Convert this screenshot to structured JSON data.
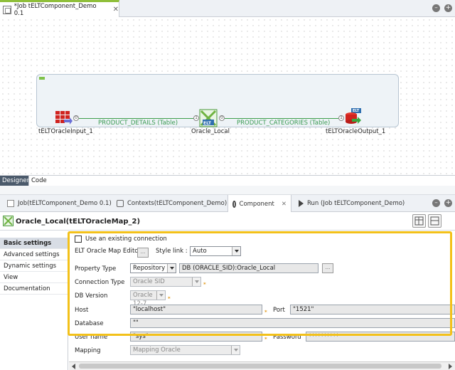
{
  "editor": {
    "tab_label": "*Job tELTComponent_Demo 0.1"
  },
  "canvas": {
    "components": {
      "input": "tELTOracleInput_1",
      "map": "Oracle_Local",
      "output": "tELTOracleOutput_1",
      "elt_badge": "ELT"
    },
    "flows": {
      "first": "PRODUCT_DETAILS (Table)",
      "second": "PRODUCT_CATEGORIES (Table)"
    },
    "ports": {
      "out0": "0",
      "in0": "1",
      "in0b": "0",
      "in1": "1"
    }
  },
  "designer_tabs": {
    "designer": "Designer",
    "code": "Code"
  },
  "view_tabs": {
    "job": "Job(tELTComponent_Demo 0.1)",
    "contexts": "Contexts(tELTComponent_Demo)",
    "component": "Component",
    "run": "Run (Job tELTComponent_Demo)"
  },
  "component": {
    "title": "Oracle_Local(tELTOracleMap_2)"
  },
  "nav": {
    "items": [
      "Basic settings",
      "Advanced settings",
      "Dynamic settings",
      "View",
      "Documentation"
    ]
  },
  "settings": {
    "use_existing_connection": "Use an existing connection",
    "map_editor_label": "ELT Oracle Map Editor",
    "ellipsis": "...",
    "style_link_label": "Style link :",
    "style_link_value": "Auto",
    "property_type_label": "Property Type",
    "property_type_value": "Repository",
    "property_repo_value": "DB (ORACLE_SID):Oracle_Local",
    "connection_type_label": "Connection Type",
    "connection_type_value": "Oracle SID",
    "db_version_label": "DB Version",
    "db_version_value": "Oracle 12-7",
    "host_label": "Host",
    "host_value": "\"localhost\"",
    "port_label": "Port",
    "port_value": "\"1521\"",
    "database_label": "Database",
    "database_value": "\"\"",
    "username_label": "User name",
    "username_value": "\"sys\"",
    "password_label": "Password",
    "password_value": "**********",
    "mapping_label": "Mapping",
    "mapping_value": "Mapping Oracle"
  },
  "colors": {
    "highlight": "#f3c11a",
    "flow": "#3e9f4d",
    "tab_accent": "#8fbf3a"
  }
}
